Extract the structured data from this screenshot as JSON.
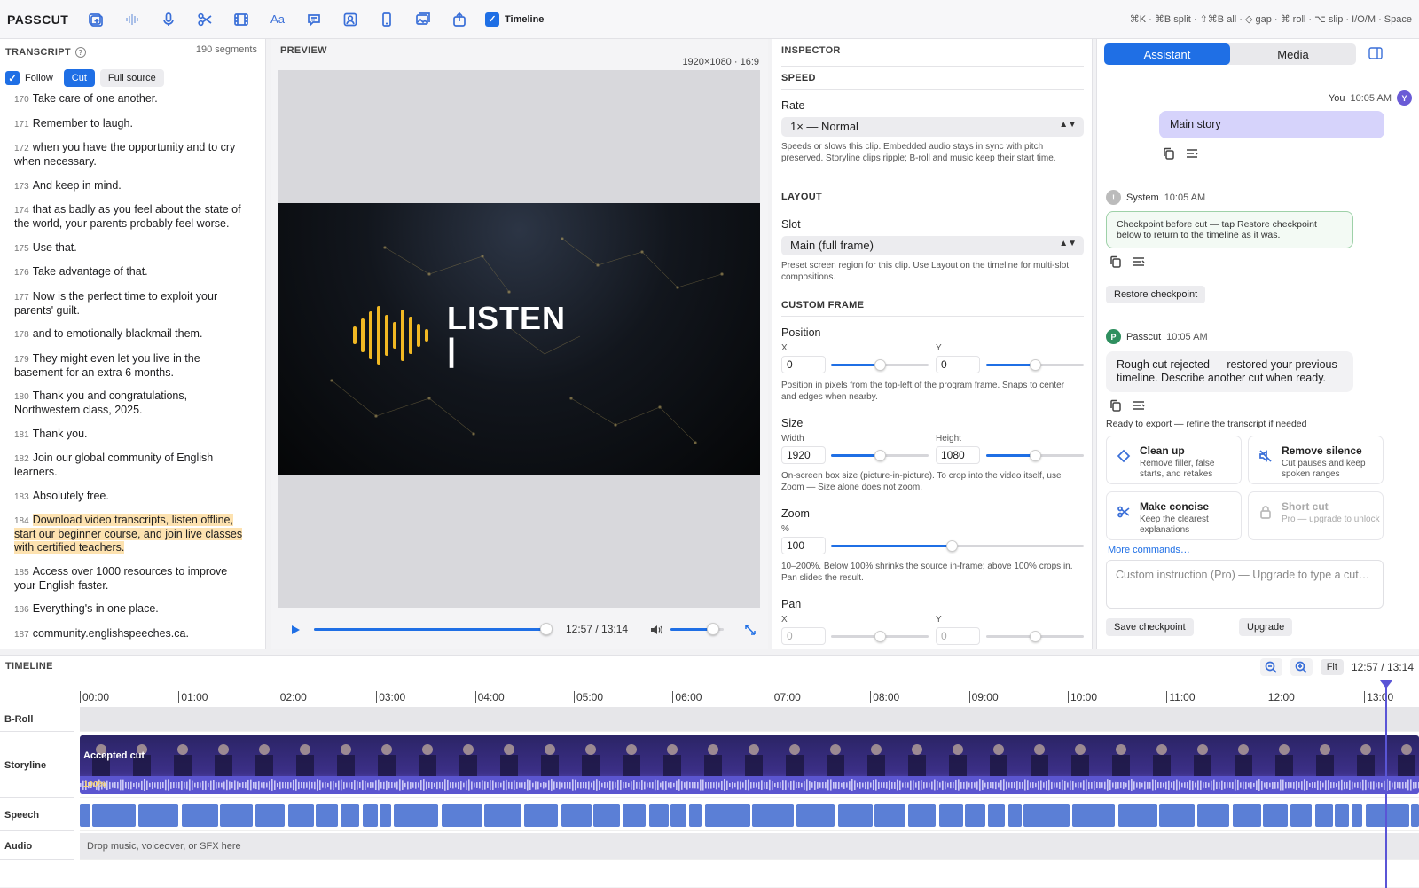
{
  "app": {
    "brand": "PASSCUT",
    "timeline_toggle_label": "Timeline",
    "shortcuts": "⌘K · ⌘B split · ⇧⌘B all · ◇ gap · ⌘ roll · ⌥ slip · I/O/M · Space"
  },
  "toolbar_icons": [
    "add-media-icon",
    "waveform-icon",
    "mic-icon",
    "scissors-icon",
    "film-icon",
    "text-icon",
    "caption-icon",
    "portrait-icon",
    "phone-icon",
    "images-icon",
    "share-icon"
  ],
  "transcript": {
    "title": "TRANSCRIPT",
    "segment_count": "190 segments",
    "follow_label": "Follow",
    "cut_label": "Cut",
    "full_source_label": "Full source",
    "segments": [
      {
        "n": "170",
        "text": "Take care of one another."
      },
      {
        "n": "171",
        "text": "Remember to laugh."
      },
      {
        "n": "172",
        "text": "when you have the opportunity and to cry when necessary."
      },
      {
        "n": "173",
        "text": "And keep in mind."
      },
      {
        "n": "174",
        "text": "that as badly as you feel about the state of the world, your parents probably feel worse."
      },
      {
        "n": "175",
        "text": "Use that."
      },
      {
        "n": "176",
        "text": "Take advantage of that."
      },
      {
        "n": "177",
        "text": "Now is the perfect time to exploit your parents' guilt."
      },
      {
        "n": "178",
        "text": "and to emotionally blackmail them."
      },
      {
        "n": "179",
        "text": "They might even let you live in the basement for an extra 6 months."
      },
      {
        "n": "180",
        "text": "Thank you and congratulations, Northwestern class, 2025."
      },
      {
        "n": "181",
        "text": "Thank you."
      },
      {
        "n": "182",
        "text": "Join our global community of English learners."
      },
      {
        "n": "183",
        "text": "Absolutely free."
      },
      {
        "n": "184",
        "text": "Download video transcripts, listen offline, start our beginner course, and join live classes with certified teachers.",
        "highlight": true
      },
      {
        "n": "185",
        "text": "Access over 1000 resources to improve your English faster."
      },
      {
        "n": "186",
        "text": "Everything's in one place."
      },
      {
        "n": "187",
        "text": "community.englishspeeches.ca."
      },
      {
        "n": "188",
        "text": "Let's speak English."
      }
    ]
  },
  "preview": {
    "title": "PREVIEW",
    "resolution": "1920×1080 · 16:9",
    "video_text": "LISTEN",
    "playback_progress": 0.97,
    "volume": 0.8,
    "time": "12:57 / 13:14"
  },
  "inspector": {
    "title": "INSPECTOR",
    "speed_section": "SPEED",
    "rate_label": "Rate",
    "rate_value": "1× — Normal",
    "rate_help": "Speeds or slows this clip. Embedded audio stays in sync with pitch preserved. Storyline clips ripple; B-roll and music keep their start time.",
    "layout_section": "LAYOUT",
    "slot_label": "Slot",
    "slot_value": "Main (full frame)",
    "slot_help": "Preset screen region for this clip. Use Layout on the timeline for multi-slot compositions.",
    "custom_frame_section": "CUSTOM FRAME",
    "position_label": "Position",
    "x_label": "X",
    "y_label": "Y",
    "pos_x": "0",
    "pos_y": "0",
    "position_help": "Position in pixels from the top-left of the program frame. Snaps to center and edges when nearby.",
    "size_label": "Size",
    "width_label": "Width",
    "height_label": "Height",
    "width_value": "1920",
    "height_value": "1080",
    "size_help": "On-screen box size (picture-in-picture). To crop into the video itself, use Zoom — Size alone does not zoom.",
    "zoom_label": "Zoom",
    "zoom_unit": "%",
    "zoom_value": "100",
    "zoom_help": "10–200%. Below 100% shrinks the source in-frame; above 100% crops in. Pan slides the result.",
    "pan_label": "Pan",
    "pan_x": "0",
    "pan_y": "0"
  },
  "assistant": {
    "tab_assistant": "Assistant",
    "tab_media": "Media",
    "user_name": "You",
    "user_time": "10:05 AM",
    "user_avatar": "Y",
    "user_message": "Main story",
    "system_name": "System",
    "system_time": "10:05 AM",
    "system_avatar": "!",
    "system_message": "Checkpoint before cut — tap Restore checkpoint below to return to the timeline as it was.",
    "restore_label": "Restore checkpoint",
    "bot_name": "Passcut",
    "bot_time": "10:05 AM",
    "bot_avatar": "P",
    "bot_message": "Rough cut rejected — restored your previous timeline. Describe another cut when ready.",
    "ready_label": "Ready to export — refine the transcript if needed",
    "cards": [
      {
        "title": "Clean up",
        "desc": "Remove filler, false starts, and retakes",
        "icon": "eraser-icon"
      },
      {
        "title": "Remove silence",
        "desc": "Cut pauses and keep spoken ranges",
        "icon": "mute-icon"
      },
      {
        "title": "Make concise",
        "desc": "Keep the clearest explanations",
        "icon": "scissors-icon"
      },
      {
        "title": "Short cut",
        "desc": "Pro — upgrade to unlock",
        "icon": "lock-icon"
      }
    ],
    "more_commands": "More commands…",
    "input_placeholder": "Custom instruction (Pro) — Upgrade to type a cut…",
    "save_checkpoint": "Save checkpoint",
    "upgrade": "Upgrade"
  },
  "timeline": {
    "title": "TIMELINE",
    "fit_label": "Fit",
    "time": "12:57 / 13:14",
    "ticks": [
      "00:00",
      "01:00",
      "02:00",
      "03:00",
      "04:00",
      "05:00",
      "06:00",
      "07:00",
      "08:00",
      "09:00",
      "10:00",
      "11:00",
      "12:00",
      "13:00"
    ],
    "tracks": {
      "broll": "B-Roll",
      "storyline": "Storyline",
      "speech": "Speech",
      "audio": "Audio"
    },
    "clip_label": "Accepted cut",
    "clip_volume": "100%",
    "audio_drop": "Drop music, voiceover, or SFX here",
    "playhead_time": "12:57"
  },
  "colors": {
    "accent": "#1f6fe5",
    "storyline": "#3b2f86",
    "speech": "#5b7fd6",
    "highlight": "#fde2b0",
    "user_bubble": "#d6d3fb"
  }
}
